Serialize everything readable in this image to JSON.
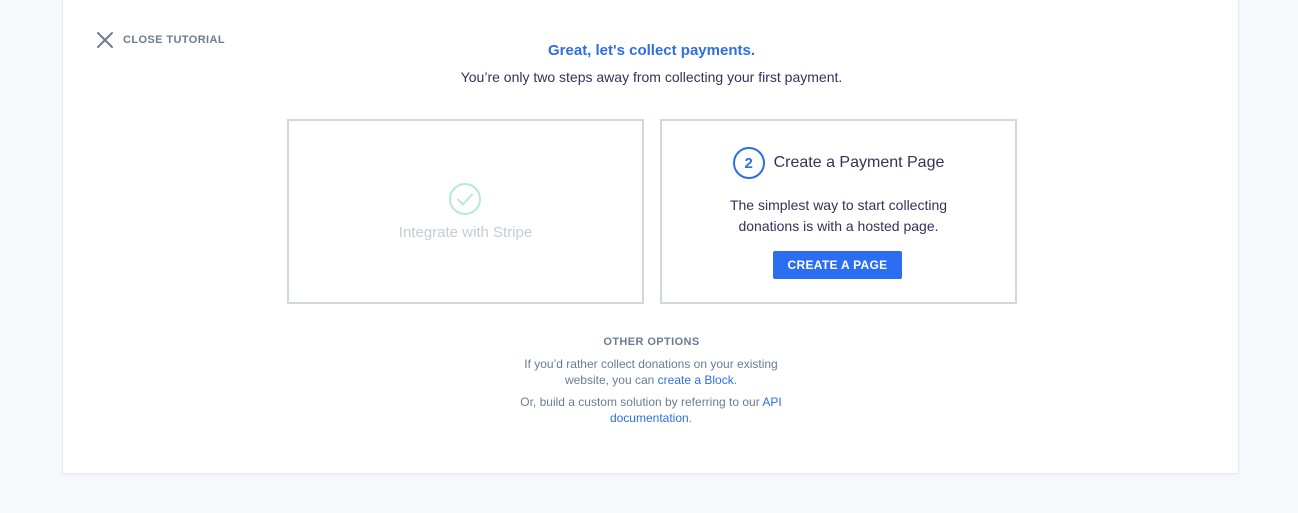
{
  "close_tutorial": {
    "label": "CLOSE TUTORIAL",
    "icon": "close-icon"
  },
  "headline": "Great, let's collect payments.",
  "subline": "You’re only two steps away from collecting your first payment.",
  "steps": [
    {
      "label": "Integrate with Stripe",
      "status": "complete",
      "icon": "check-circle-icon"
    },
    {
      "number": "2",
      "title": "Create a Payment Page",
      "description": "The simplest way to start collecting donations is with a hosted page.",
      "button_label": "CREATE A PAGE"
    }
  ],
  "other_options": {
    "heading": "OTHER OPTIONS",
    "p1_text": "If you’d rather collect donations on your existing website, you can ",
    "p1_link": "create a Block",
    "p1_end": ".",
    "p2_text": "Or, build a custom solution by referring to our ",
    "p2_link": "API documentation",
    "p2_end": "."
  },
  "colors": {
    "accent": "#2d6ee6",
    "button": "#2c6ef2",
    "success": "#b6ebd0",
    "muted_text": "#6b7c93",
    "border": "#cfd7df",
    "background": "#f6f9fc"
  }
}
